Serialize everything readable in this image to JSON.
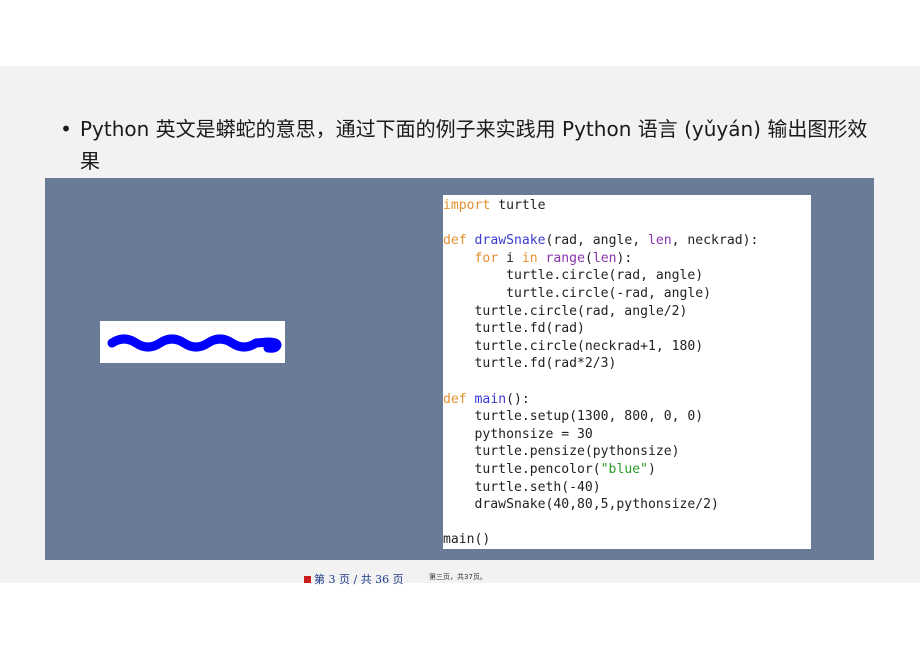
{
  "bullet": {
    "symbol": "•",
    "text": "Python 英文是蟒蛇的意思，通过下面的例子来实践用 Python 语言 (yǔyán) 输出图形效果"
  },
  "figure": {
    "background_color": "#6a7b97",
    "snake_color": "#0000ff",
    "code_lines": [
      [
        {
          "t": "import",
          "c": "kw"
        },
        {
          "t": " turtle"
        }
      ],
      [],
      [
        {
          "t": "def",
          "c": "kw"
        },
        {
          "t": " "
        },
        {
          "t": "drawSnake",
          "c": "fn"
        },
        {
          "t": "(rad, angle, "
        },
        {
          "t": "len",
          "c": "bi"
        },
        {
          "t": ", neckrad):"
        }
      ],
      [
        {
          "t": "    "
        },
        {
          "t": "for",
          "c": "kw"
        },
        {
          "t": " i "
        },
        {
          "t": "in",
          "c": "kw"
        },
        {
          "t": " "
        },
        {
          "t": "range",
          "c": "bi"
        },
        {
          "t": "("
        },
        {
          "t": "len",
          "c": "bi"
        },
        {
          "t": "):"
        }
      ],
      [
        {
          "t": "        turtle.circle(rad, angle)"
        }
      ],
      [
        {
          "t": "        turtle.circle(-rad, angle)"
        }
      ],
      [
        {
          "t": "    turtle.circle(rad, angle/2)"
        }
      ],
      [
        {
          "t": "    turtle.fd(rad)"
        }
      ],
      [
        {
          "t": "    turtle.circle(neckrad+1, 180)"
        }
      ],
      [
        {
          "t": "    turtle.fd(rad*2/3)"
        }
      ],
      [],
      [
        {
          "t": "def",
          "c": "kw"
        },
        {
          "t": " "
        },
        {
          "t": "main",
          "c": "fn"
        },
        {
          "t": "():"
        }
      ],
      [
        {
          "t": "    turtle.setup(1300, 800, 0, 0)"
        }
      ],
      [
        {
          "t": "    pythonsize = 30"
        }
      ],
      [
        {
          "t": "    turtle.pensize(pythonsize)"
        }
      ],
      [
        {
          "t": "    turtle.pencolor("
        },
        {
          "t": "\"blue\"",
          "c": "str"
        },
        {
          "t": ")"
        }
      ],
      [
        {
          "t": "    turtle.seth(-40)"
        }
      ],
      [
        {
          "t": "    drawSnake(40,80,5,pythonsize/2)"
        }
      ],
      [],
      [
        {
          "t": "main()"
        }
      ]
    ]
  },
  "footer": {
    "page_label": "第 3 页 / 共 36 页",
    "note": "第三页，共37页。"
  }
}
